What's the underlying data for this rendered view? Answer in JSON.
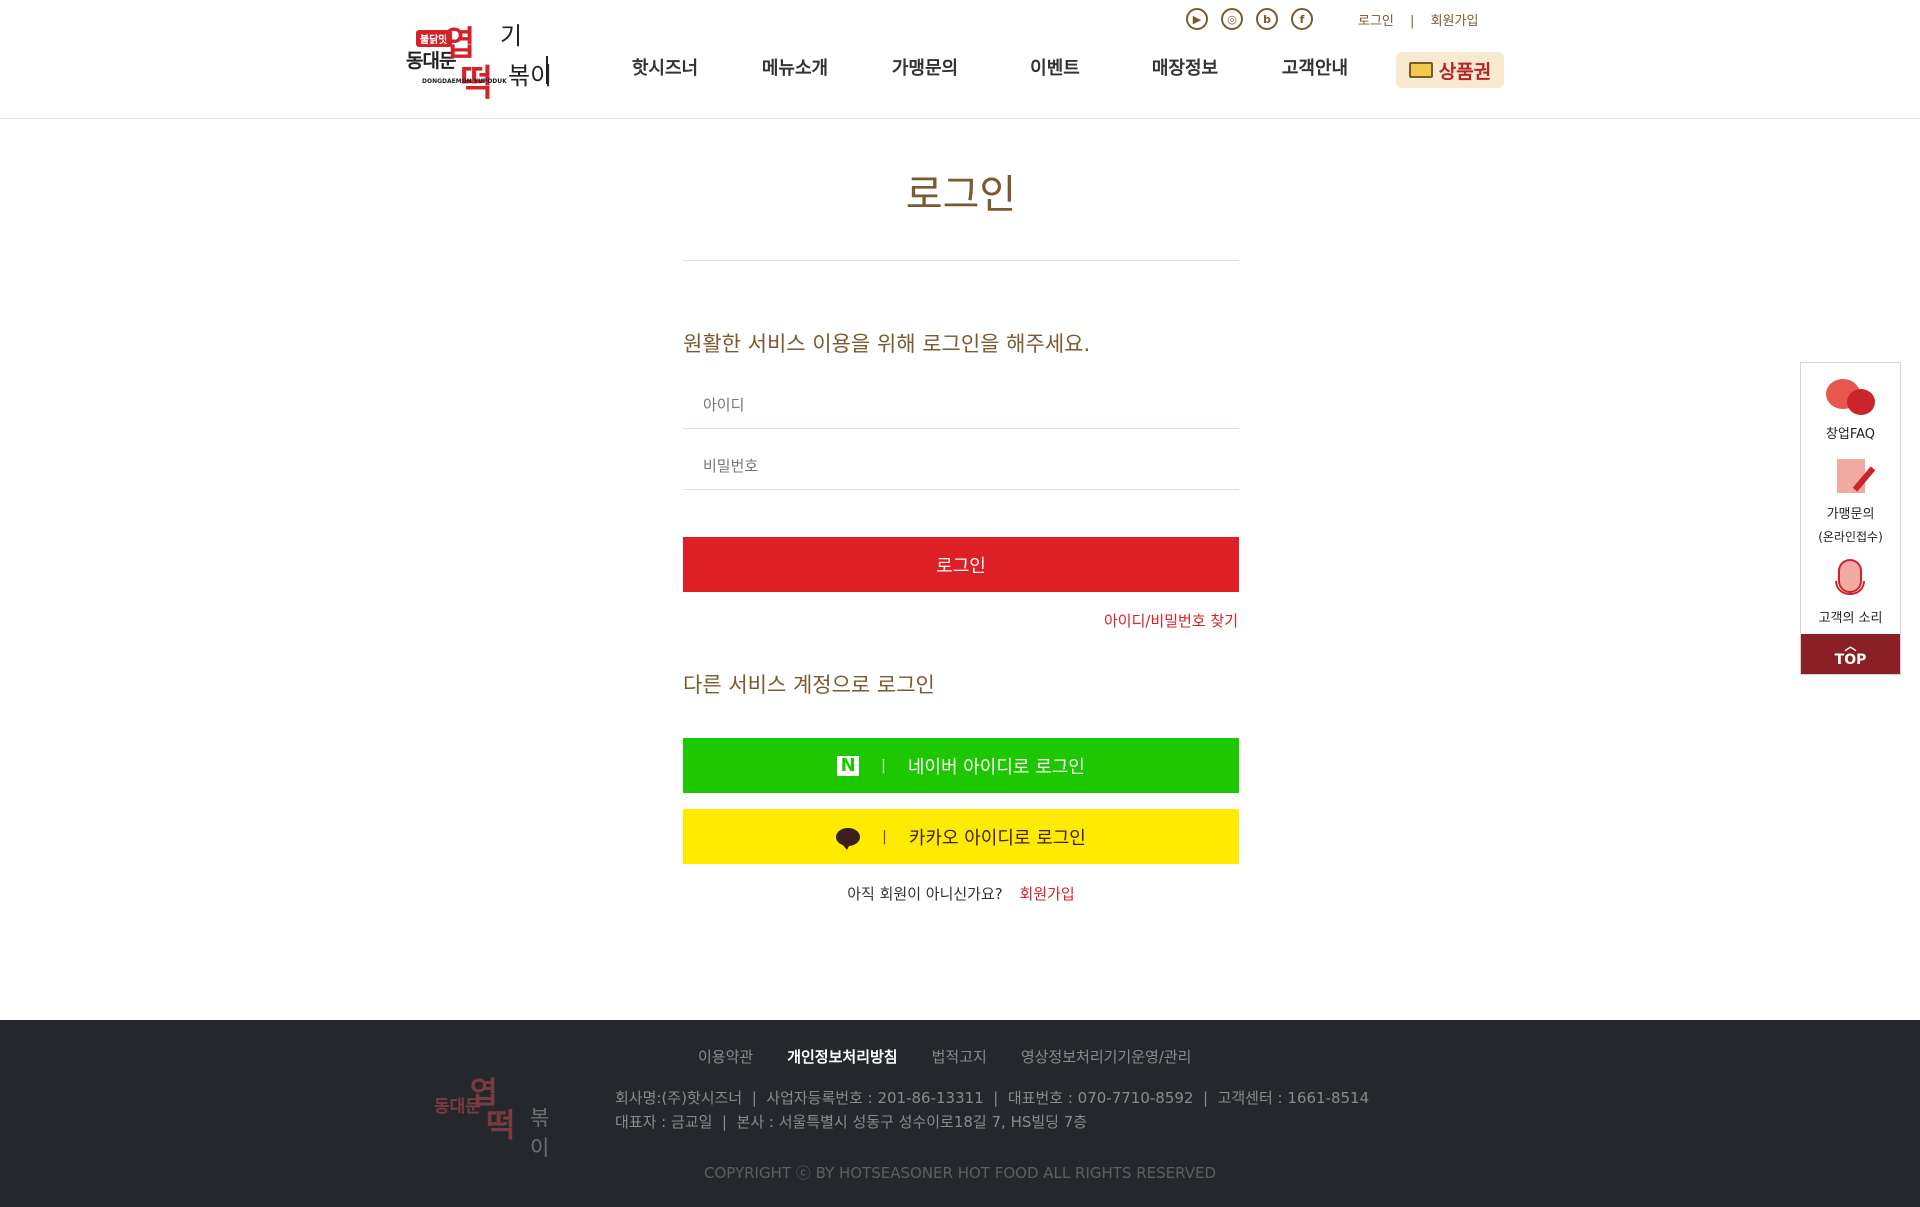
{
  "header": {
    "logo": {
      "badge": "불닭맛",
      "line1": "동대문",
      "big1": "엽",
      "ki": "기",
      "big2": "떡",
      "bok": "볶이",
      "en": "DONGDAEMUN YUPDDUK"
    },
    "sns": [
      {
        "icon": "youtube-icon",
        "glyph": "▶"
      },
      {
        "icon": "instagram-icon",
        "glyph": "◎"
      },
      {
        "icon": "blog-icon",
        "glyph": "b"
      },
      {
        "icon": "facebook-icon",
        "glyph": "f"
      }
    ],
    "toplinks": {
      "login": "로그인",
      "sep": "|",
      "join": "회원가입"
    },
    "gnb": [
      "핫시즈너",
      "메뉴소개",
      "가맹문의",
      "이벤트",
      "매장정보",
      "고객안내"
    ],
    "voucher": "상품권"
  },
  "login": {
    "title": "로그인",
    "guide": "원활한 서비스 이용을 위해 로그인을 해주세요.",
    "id_placeholder": "아이디",
    "pw_placeholder": "비밀번호",
    "button": "로그인",
    "find": "아이디/비밀번호 찾기",
    "other": "다른 서비스 계정으로 로그인",
    "naver": "네이버 아이디로 로그인",
    "kakao": "카카오 아이디로 로그인",
    "sep": "|",
    "not_member": "아직 회원이 아니신가요?",
    "join": "회원가입"
  },
  "quick": {
    "faq": "창업FAQ",
    "inquiry": "가맹문의",
    "inquiry_sub": "(온라인접수)",
    "voice": "고객의 소리",
    "top": "TOP"
  },
  "footer": {
    "logo": {
      "l1": "동대문",
      "l2": "엽",
      "l3": "떡",
      "l4": "볶이"
    },
    "links": [
      "이용약관",
      "개인정보처리방침",
      "법적고지",
      "영상정보처리기기운영/관리"
    ],
    "info1": "회사명:(주)핫시즈너  |  사업자등록번호 : 201-86-13311  |  대표번호 : 070-7710-8592  |  고객센터 : 1661-8514",
    "info2": "대표자 : 금교일  |  본사 : 서울특별시 성동구 성수이로18길 7, HS빌딩 7층",
    "copyright": "COPYRIGHT ⓒ BY HOTSEASONER HOT FOOD ALL RIGHTS RESERVED"
  },
  "colors": {
    "brand_red": "#dd1f26",
    "brown": "#7a5a2f",
    "naver_green": "#1ec800",
    "kakao_yellow": "#ffeb00",
    "footer_bg": "#24282c"
  }
}
